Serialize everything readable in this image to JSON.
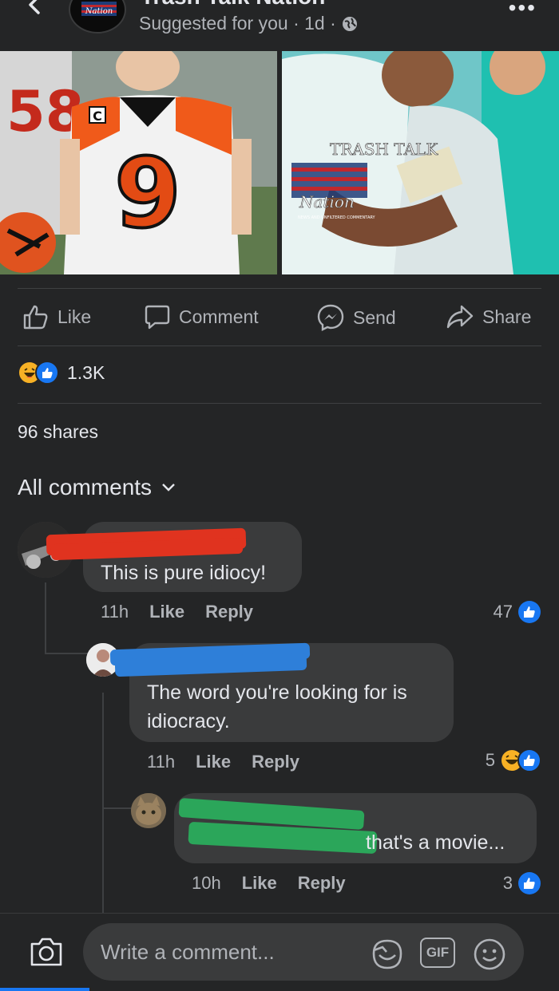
{
  "post": {
    "page_name": "Trash Talk Nation",
    "meta_text": "Suggested for you · 1d ·",
    "photo_left_jersey": "9",
    "photo_right_watermark": "TRASH TALK",
    "photo_right_watermark2": "Nation",
    "photo_right_watermark3": "NEWS AND UNFILTERED COMMENTARY"
  },
  "actions": {
    "like": "Like",
    "comment": "Comment",
    "send": "Send",
    "share": "Share"
  },
  "reactions": {
    "count": "1.3K"
  },
  "shares": "96 shares",
  "comments_header": "All comments",
  "comments": [
    {
      "text": "This is pure idiocy!",
      "time": "11h",
      "like": "Like",
      "reply": "Reply",
      "reaction_count": "47"
    },
    {
      "text": "The word you're looking for is idiocracy.",
      "time": "11h",
      "like": "Like",
      "reply": "Reply",
      "reaction_count": "5"
    },
    {
      "text": "that's a movie...",
      "time": "10h",
      "like": "Like",
      "reply": "Reply",
      "reaction_count": "3"
    }
  ],
  "composer": {
    "placeholder": "Write a comment...",
    "gif_label": "GIF"
  },
  "colors": {
    "background": "#242526",
    "bubble": "#3a3b3c",
    "accent": "#1877f2",
    "redact_red": "#e0331f",
    "redact_blue": "#2e7fd9",
    "redact_green": "#2ba65a"
  }
}
